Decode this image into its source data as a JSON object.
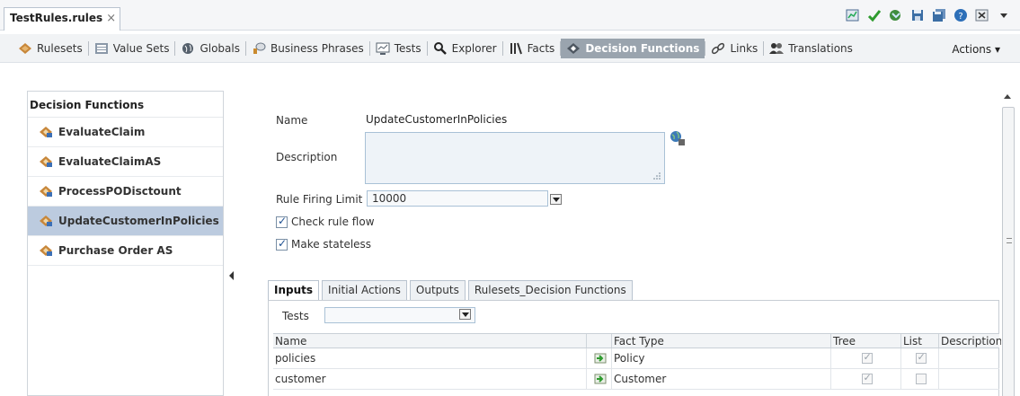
{
  "window": {
    "tab_title": "TestRules.rules",
    "tab_close": "×"
  },
  "top_icons": [
    "report-icon",
    "validate-check-icon",
    "deploy-icon",
    "save-icon",
    "save-all-icon",
    "help-icon",
    "close-window-icon",
    "menu-dropdown-icon"
  ],
  "nav": {
    "items": [
      {
        "label": "Rulesets",
        "icon": "rulesets-icon"
      },
      {
        "label": "Value Sets",
        "icon": "value-sets-icon"
      },
      {
        "label": "Globals",
        "icon": "globals-icon"
      },
      {
        "label": "Business Phrases",
        "icon": "business-phrases-icon"
      },
      {
        "label": "Tests",
        "icon": "tests-icon"
      },
      {
        "label": "Explorer",
        "icon": "explorer-search-icon"
      },
      {
        "label": "Facts",
        "icon": "facts-icon"
      },
      {
        "label": "Decision Functions",
        "icon": "decision-functions-icon",
        "active": true
      },
      {
        "label": "Links",
        "icon": "links-icon"
      },
      {
        "label": "Translations",
        "icon": "translations-icon"
      }
    ],
    "actions_label": "Actions ▾"
  },
  "left": {
    "title": "Decision Functions",
    "items": [
      {
        "label": "EvaluateClaim"
      },
      {
        "label": "EvaluateClaimAS"
      },
      {
        "label": "ProcessPODisctount"
      },
      {
        "label": "UpdateCustomerInPolicies",
        "selected": true
      },
      {
        "label": "Purchase Order AS"
      }
    ]
  },
  "form": {
    "name_label": "Name",
    "name_value": "UpdateCustomerInPolicies",
    "description_label": "Description",
    "description_value": "",
    "limit_label": "Rule Firing Limit",
    "limit_value": "10000",
    "check_rule_flow_label": "Check rule flow",
    "check_rule_flow": true,
    "make_stateless_label": "Make stateless",
    "make_stateless": true
  },
  "subtabs": [
    {
      "label": "Inputs",
      "active": true
    },
    {
      "label": "Initial Actions"
    },
    {
      "label": "Outputs"
    },
    {
      "label": "Rulesets_Decision Functions"
    }
  ],
  "inputs": {
    "tests_label": "Tests",
    "tests_value": "",
    "columns": [
      "Name",
      "",
      "Fact Type",
      "Tree",
      "List",
      "Description"
    ],
    "rows": [
      {
        "name": "policies",
        "fact_type": "Policy",
        "tree": true,
        "list": true,
        "description": ""
      },
      {
        "name": "customer",
        "fact_type": "Customer",
        "tree": true,
        "list": false,
        "description": ""
      }
    ]
  },
  "colors": {
    "selected_row": "#bccbdf",
    "active_nav": "#9aa4ae",
    "input_bg": "#eef3f8",
    "check_green": "#2e9b2e"
  }
}
